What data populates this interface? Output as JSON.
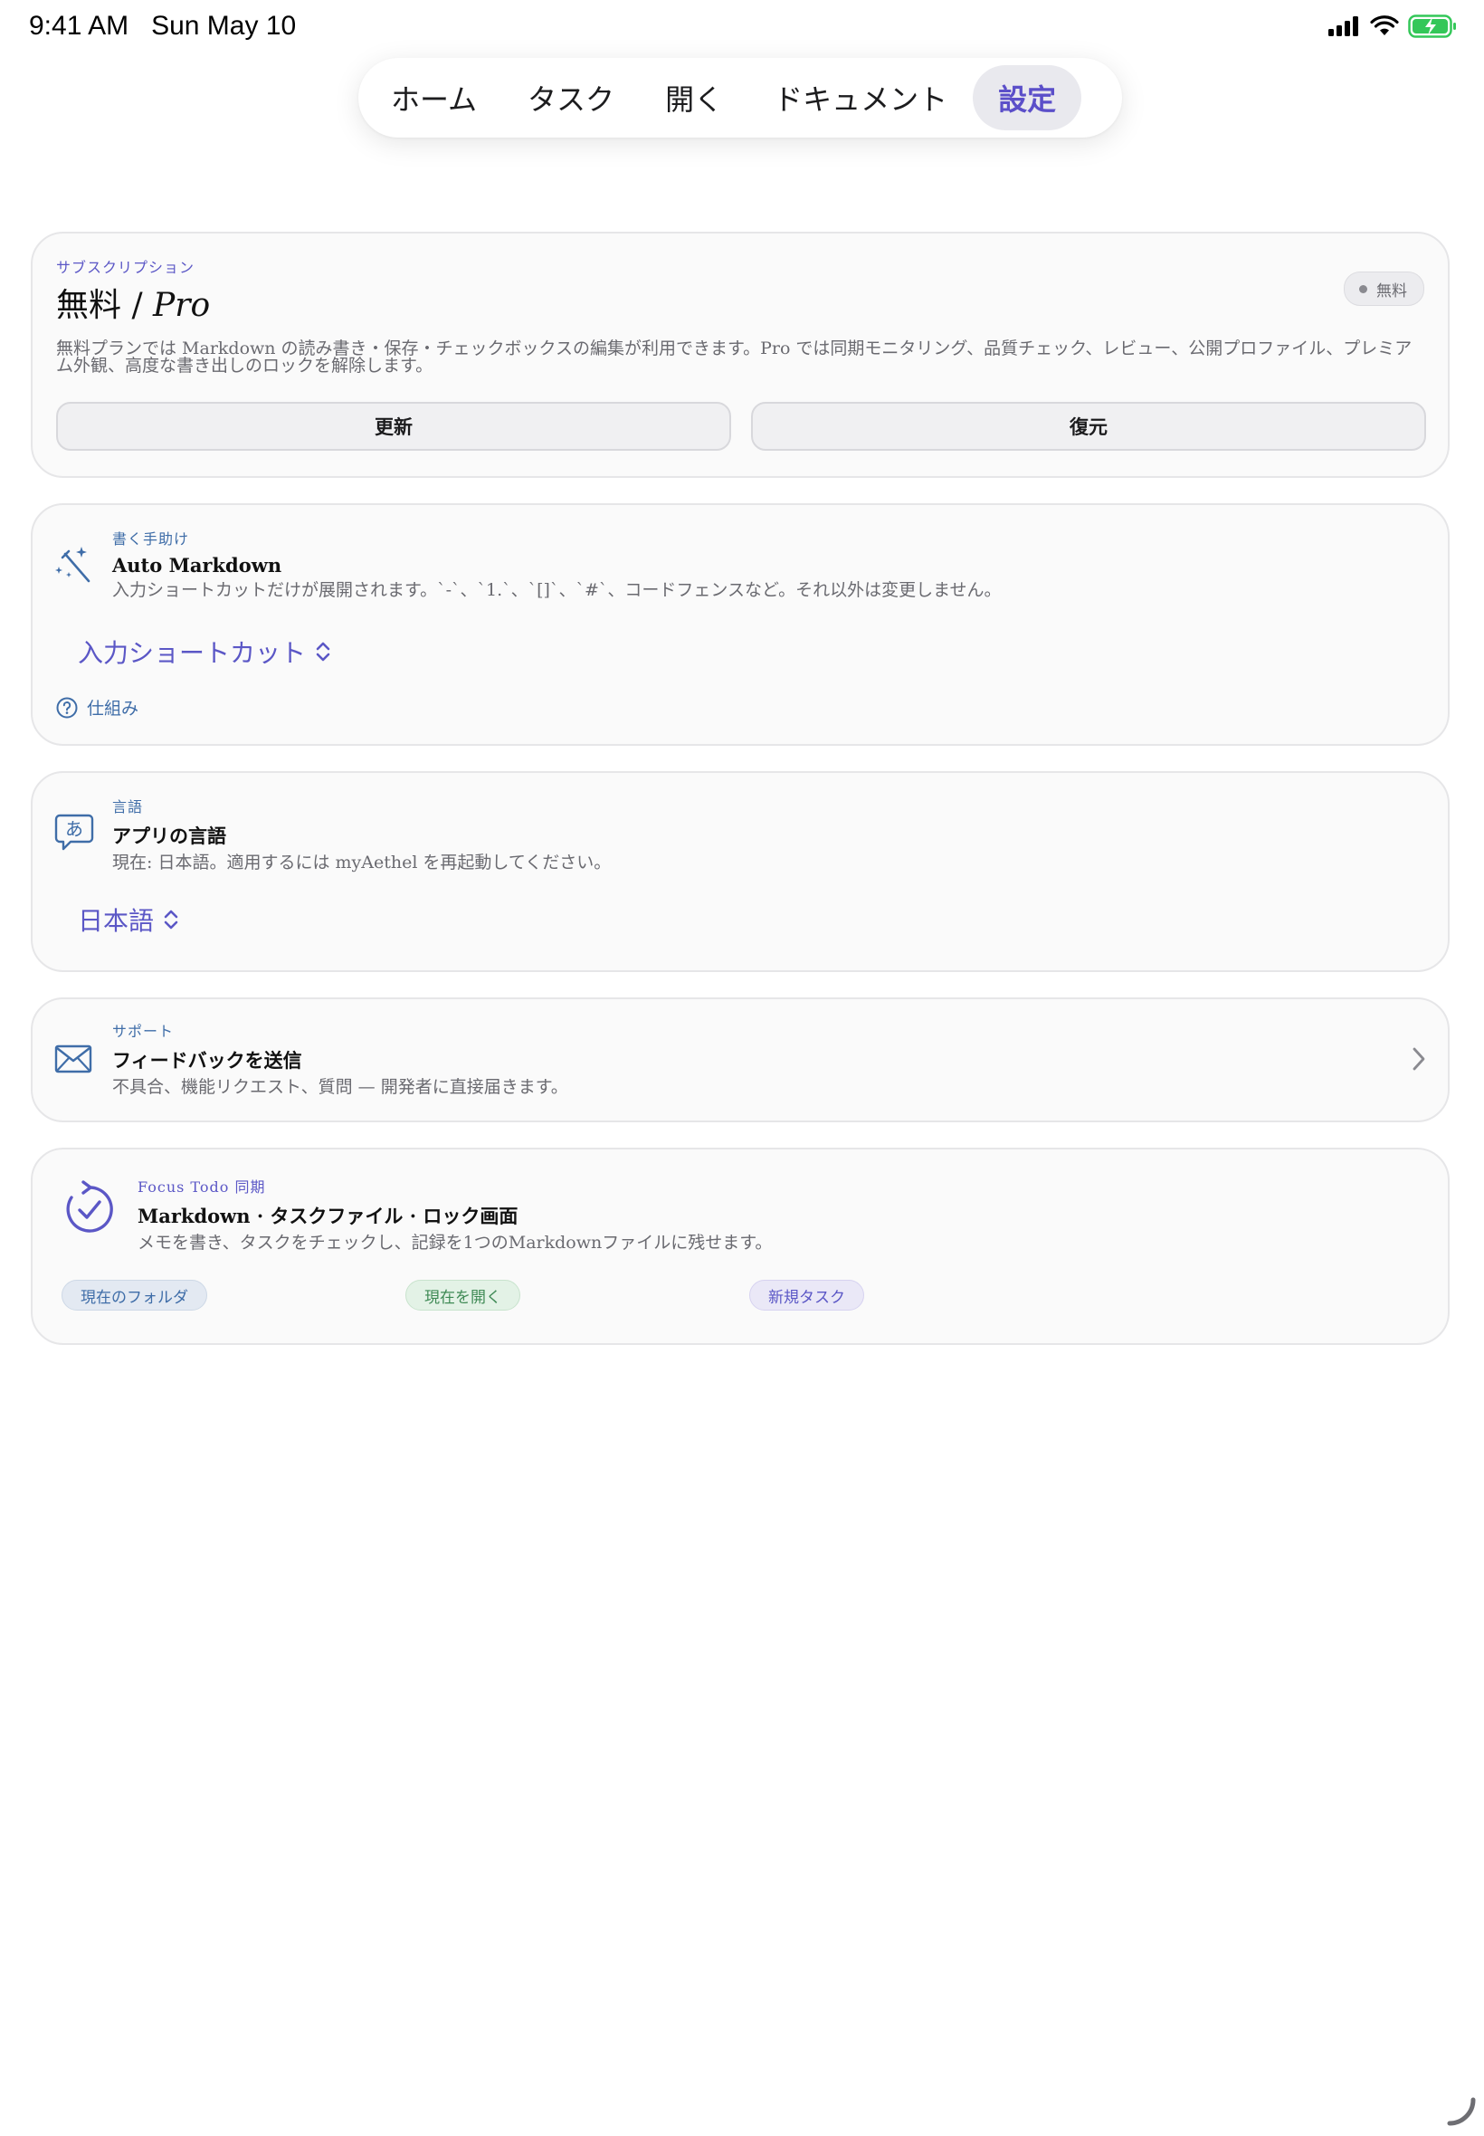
{
  "status_bar": {
    "time": "9:41 AM",
    "date": "Sun May 10"
  },
  "nav": {
    "tabs": [
      {
        "label": "ホーム",
        "active": false
      },
      {
        "label": "タスク",
        "active": false
      },
      {
        "label": "開く",
        "active": false
      },
      {
        "label": "ドキュメント",
        "active": false
      },
      {
        "label": "設定",
        "active": true
      }
    ]
  },
  "subscription": {
    "eyebrow": "サブスクリプション",
    "title_prefix": "無料 / ",
    "title_pro": "Pro",
    "badge": "無料",
    "description": "無料プランでは Markdown の読み書き・保存・チェックボックスの編集が利用できます。Pro では同期モニタリング、品質チェック、レビュー、公開プロファイル、プレミアム外観、高度な書き出しのロックを解除します。",
    "refresh_button": "更新",
    "restore_button": "復元"
  },
  "writing_helper": {
    "eyebrow": "書く手助け",
    "title": "Auto Markdown",
    "description": "入力ショートカットだけが展開されます。`-`、`1.`、`[]`、`#`、コードフェンスなど。それ以外は変更しません。",
    "picker_value": "入力ショートカット",
    "help_link": "仕組み",
    "icon": "magic-wand-icon"
  },
  "language": {
    "eyebrow": "言語",
    "title": "アプリの言語",
    "description": "現在: 日本語。適用するには myAethel を再起動してください。",
    "picker_value": "日本語",
    "icon": "language-bubble-icon"
  },
  "support": {
    "eyebrow": "サポート",
    "title": "フィードバックを送信",
    "description": "不具合、機能リクエスト、質問 — 開発者に直接届きます。",
    "icon": "envelope-icon"
  },
  "focus_todo": {
    "eyebrow": "Focus Todo 同期",
    "title": "Markdown · タスクファイル · ロック画面",
    "description": "メモを書き、タスクをチェックし、記録を1つのMarkdownファイルに残せます。",
    "chips": [
      "現在のフォルダ",
      "現在を開く",
      "新規タスク"
    ],
    "icon": "sync-check-icon"
  },
  "colors": {
    "accent": "#5b57c6",
    "link_blue": "#3f6da8",
    "battery_green": "#34c759",
    "card_bg": "#fafafa"
  }
}
